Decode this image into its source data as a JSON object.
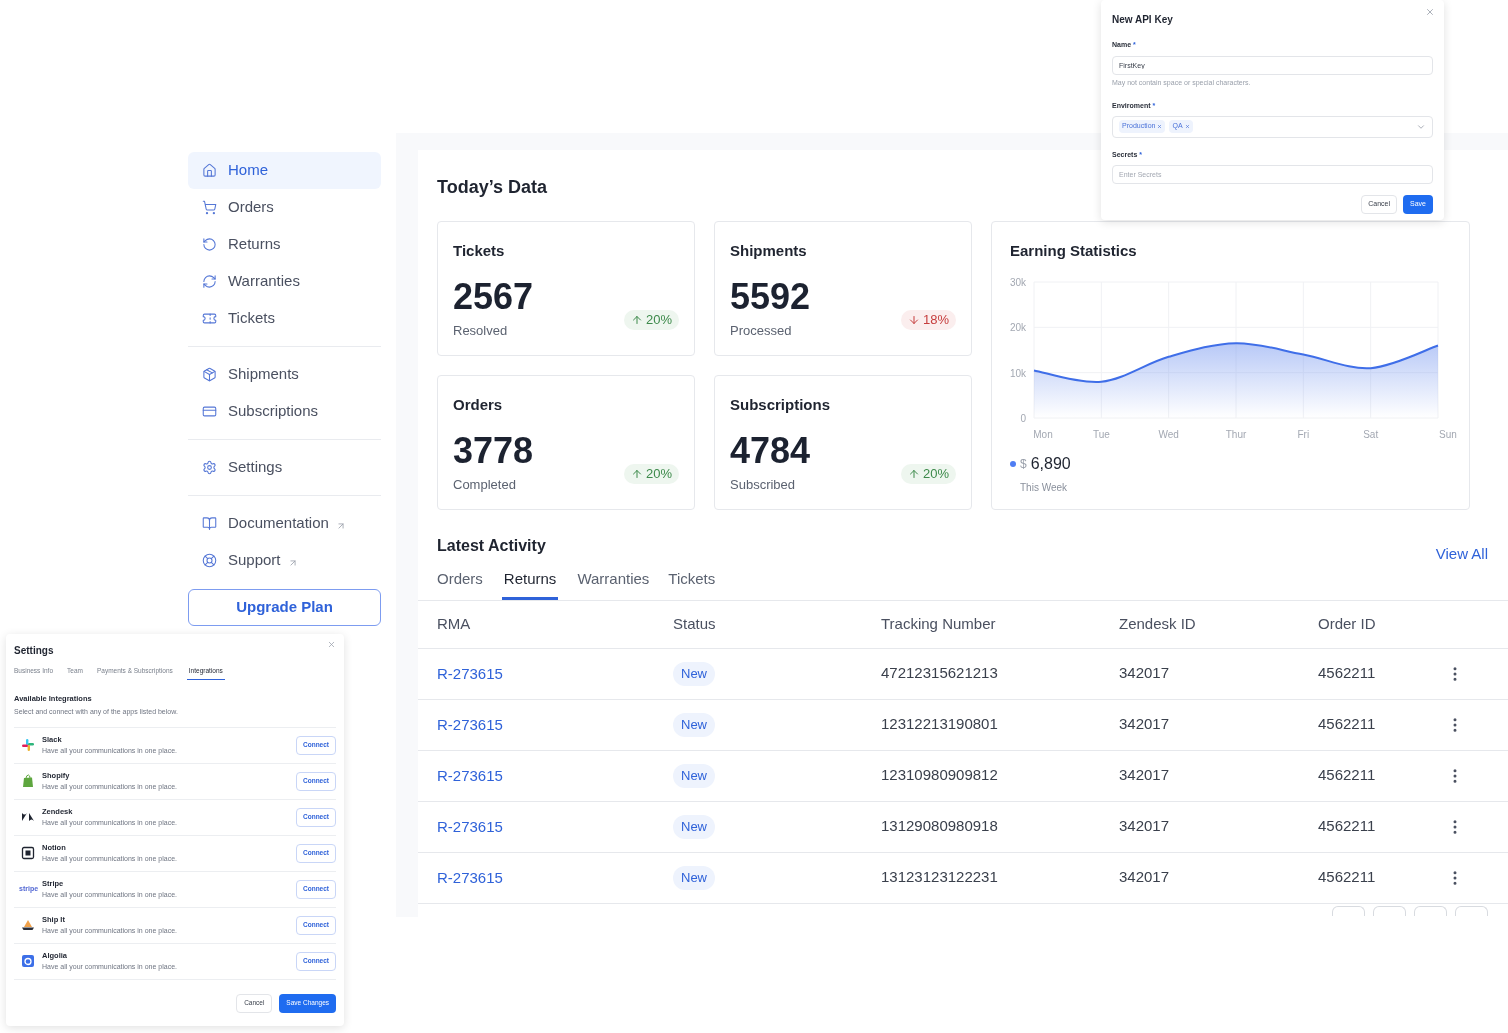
{
  "sidebar": {
    "groups": [
      {
        "items": [
          {
            "label": "Home",
            "selected": true
          },
          {
            "label": "Orders",
            "selected": false
          },
          {
            "label": "Returns",
            "selected": false
          },
          {
            "label": "Warranties",
            "selected": false
          },
          {
            "label": "Tickets",
            "selected": false
          }
        ]
      },
      {
        "items": [
          {
            "label": "Shipments",
            "selected": false
          },
          {
            "label": "Subscriptions",
            "selected": false
          }
        ]
      },
      {
        "items": [
          {
            "label": "Settings",
            "selected": false
          }
        ]
      },
      {
        "items": [
          {
            "label": "Documentation",
            "selected": false,
            "external": true
          },
          {
            "label": "Support",
            "selected": false,
            "external": true
          }
        ]
      }
    ],
    "upgrade_button": "Upgrade Plan"
  },
  "main": {
    "title": "Today’s Data",
    "stats": [
      {
        "title": "Tickets",
        "value": "2567",
        "caption": "Resolved",
        "change": "20%",
        "increase": true
      },
      {
        "title": "Shipments",
        "value": "5592",
        "caption": "Processed",
        "change": "18%",
        "increase": false
      },
      {
        "title": "Orders",
        "value": "3778",
        "caption": "Completed",
        "change": "20%",
        "increase": true
      },
      {
        "title": "Subscriptions",
        "value": "4784",
        "caption": "Subscribed",
        "change": "20%",
        "increase": true
      }
    ],
    "earnings": {
      "title": "Earning Statistics",
      "currency": "$",
      "amount": "6,890",
      "caption": "This Week",
      "color": "#4f7df3",
      "chart_data": {
        "type": "area",
        "grid": true,
        "categories": [
          "Mon",
          "Tue",
          "Wed",
          "Thur",
          "Fri",
          "Sat",
          "Sun"
        ],
        "ylim": [
          0,
          30000
        ],
        "yticks": [
          {
            "value": 0,
            "label": "0"
          },
          {
            "value": 10000,
            "label": "10k"
          },
          {
            "value": 20000,
            "label": "20k"
          },
          {
            "value": 30000,
            "label": "30k"
          }
        ],
        "series": [
          {
            "color": "#3f6ee8",
            "values": [
              10500,
              8000,
              13500,
              16500,
              14000,
              11000,
              16000
            ]
          }
        ]
      }
    },
    "activity": {
      "title": "Latest Activity",
      "view_all": "View All",
      "tabs": [
        {
          "label": "Orders",
          "selected": false
        },
        {
          "label": "Returns",
          "selected": true
        },
        {
          "label": "Warranties",
          "selected": false
        },
        {
          "label": "Tickets",
          "selected": false
        }
      ],
      "columns": [
        "RMA",
        "Status",
        "Tracking Number",
        "Zendesk ID",
        "Order ID"
      ],
      "rows": [
        {
          "rma": "R-273615",
          "status": "New",
          "tracking": "47212315621213",
          "zendesk": "342017",
          "order": "4562211"
        },
        {
          "rma": "R-273615",
          "status": "New",
          "tracking": "12312213190801",
          "zendesk": "342017",
          "order": "4562211"
        },
        {
          "rma": "R-273615",
          "status": "New",
          "tracking": "12310980909812",
          "zendesk": "342017",
          "order": "4562211"
        },
        {
          "rma": "R-273615",
          "status": "New",
          "tracking": "13129080980918",
          "zendesk": "342017",
          "order": "4562211"
        },
        {
          "rma": "R-273615",
          "status": "New",
          "tracking": "13123123122231",
          "zendesk": "342017",
          "order": "4562211"
        }
      ]
    }
  },
  "api_key_dialog": {
    "title": "New API Key",
    "name_label": "Name",
    "name_value": "FirstKey",
    "name_hint": "May not contain space or special characters.",
    "env_label": "Enviroment",
    "env_tags": [
      "Production",
      "QA"
    ],
    "secrets_label": "Secrets",
    "secrets_placeholder": "Enter Secrets",
    "required_mark": "*",
    "cancel": "Cancel",
    "save": "Save"
  },
  "settings_dialog": {
    "title": "Settings",
    "tabs": [
      {
        "label": "Business Info",
        "selected": false
      },
      {
        "label": "Team",
        "selected": false
      },
      {
        "label": "Payments & Subscriptions",
        "selected": false
      },
      {
        "label": "Integrations",
        "selected": true
      }
    ],
    "section_title": "Available Integrations",
    "section_hint": "Select and connect with any of the apps listed below.",
    "integrations": [
      {
        "name": "Slack",
        "description": "Have all your communications in one place.",
        "action": "Connect"
      },
      {
        "name": "Shopify",
        "description": "Have all your communications in one place.",
        "action": "Connect"
      },
      {
        "name": "Zendesk",
        "description": "Have all your communications in one place.",
        "action": "Connect"
      },
      {
        "name": "Notion",
        "description": "Have all your communications in one place.",
        "action": "Connect"
      },
      {
        "name": "Stripe",
        "description": "Have all your communications in one place.",
        "action": "Connect",
        "logo_text": "stripe"
      },
      {
        "name": "Ship It",
        "description": "Have all your communications in one place.",
        "action": "Connect"
      },
      {
        "name": "Algolia",
        "description": "Have all your communications in one place.",
        "action": "Connect"
      }
    ],
    "cancel": "Cancel",
    "save": "Save Changes"
  }
}
